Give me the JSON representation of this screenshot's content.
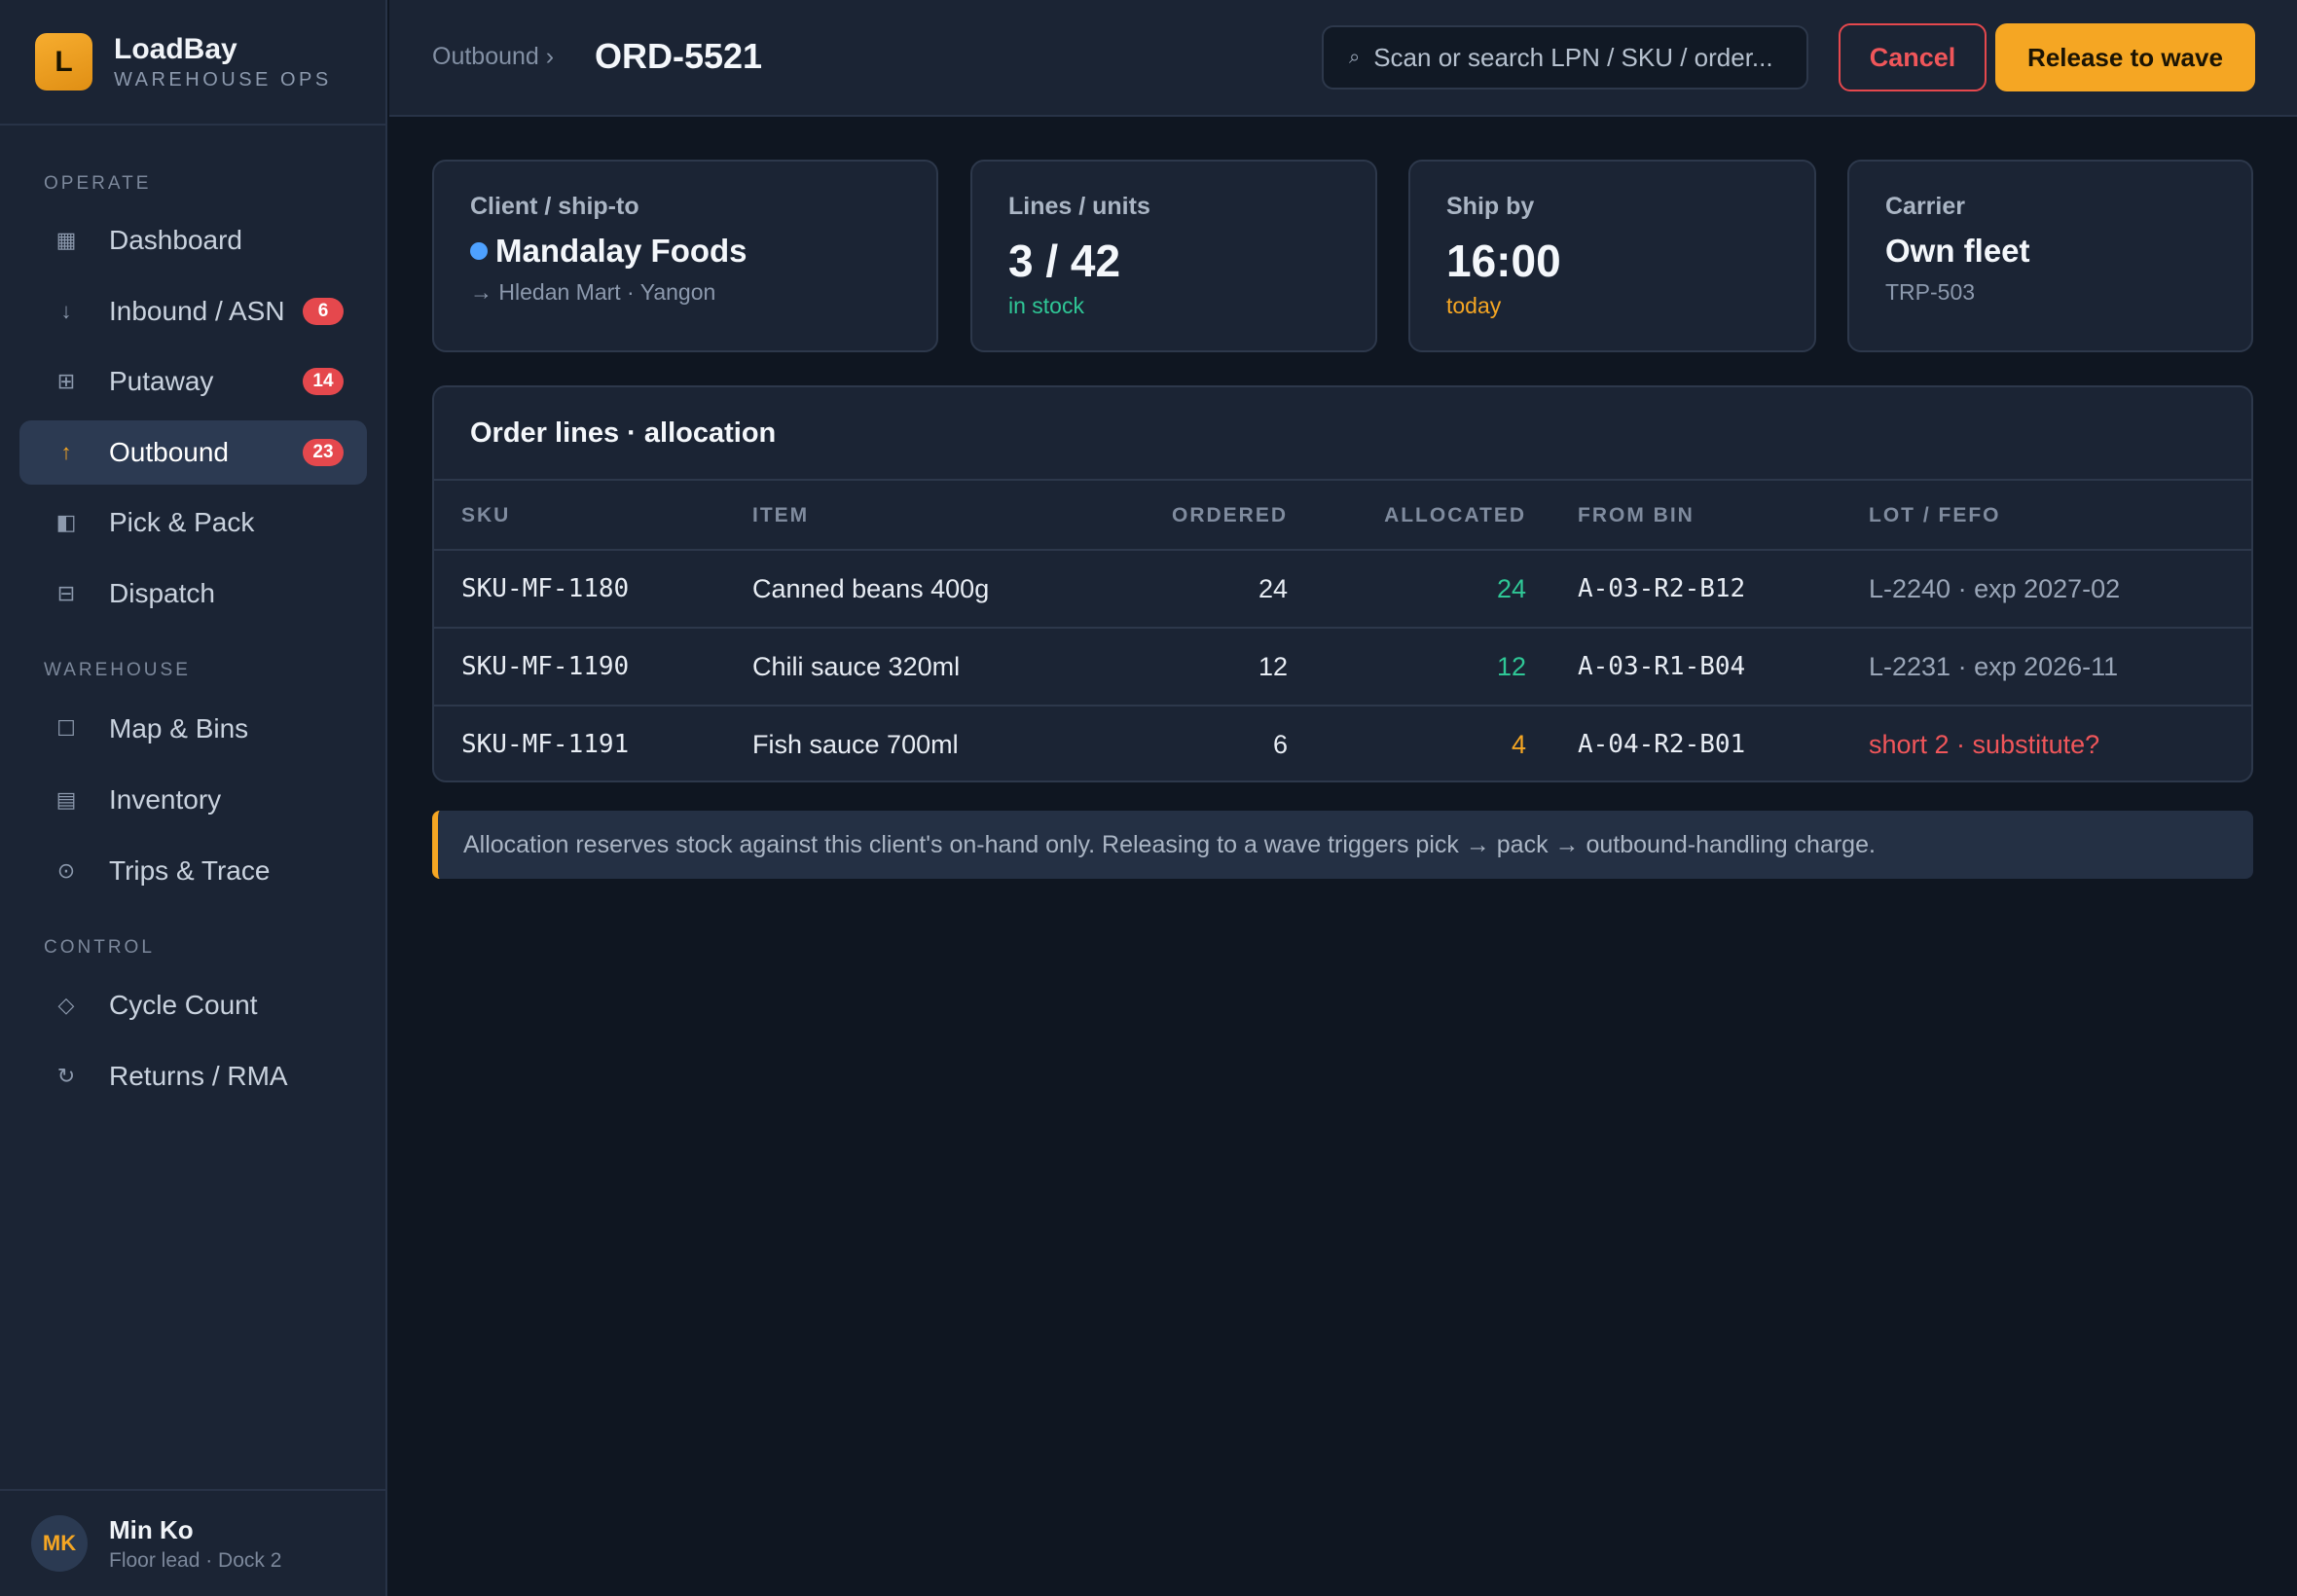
{
  "brand": {
    "logo_letter": "L",
    "name": "LoadBay",
    "subtitle": "WAREHOUSE OPS"
  },
  "sidebar": {
    "sections": [
      "OPERATE",
      "WAREHOUSE",
      "CONTROL"
    ],
    "items": [
      {
        "label": "Dashboard",
        "icon": "dashboard-icon",
        "glyph": "▦"
      },
      {
        "label": "Inbound / ASN",
        "icon": "arrow-down-icon",
        "glyph": "↓",
        "badge": "6"
      },
      {
        "label": "Putaway",
        "icon": "grid-icon",
        "glyph": "⊞",
        "badge": "14"
      },
      {
        "label": "Outbound",
        "icon": "arrow-up-icon",
        "glyph": "↑",
        "badge": "23",
        "active": true
      },
      {
        "label": "Pick & Pack",
        "icon": "box-icon",
        "glyph": "◧"
      },
      {
        "label": "Dispatch",
        "icon": "truck-icon",
        "glyph": "⊟"
      },
      {
        "label": "Map & Bins",
        "icon": "map-icon",
        "glyph": "☐"
      },
      {
        "label": "Inventory",
        "icon": "inventory-icon",
        "glyph": "▤"
      },
      {
        "label": "Trips & Trace",
        "icon": "trace-icon",
        "glyph": "⊙"
      },
      {
        "label": "Cycle Count",
        "icon": "diamond-icon",
        "glyph": "◇"
      },
      {
        "label": "Returns / RMA",
        "icon": "return-icon",
        "glyph": "↻"
      }
    ]
  },
  "user": {
    "initials": "MK",
    "name": "Min Ko",
    "role": "Floor lead · Dock 2"
  },
  "header": {
    "breadcrumb": "Outbound ›",
    "title": "ORD-5521",
    "search_placeholder": "Scan or search LPN / SKU / order...",
    "cancel_label": "Cancel",
    "release_label": "Release to wave"
  },
  "cards": {
    "client": {
      "label": "Client / ship-to",
      "value": "Mandalay Foods",
      "sub": "→ Hledan Mart · Yangon"
    },
    "lines": {
      "label": "Lines / units",
      "value": "3 / 42",
      "sub": "in stock"
    },
    "ship": {
      "label": "Ship by",
      "value": "16:00",
      "sub": "today"
    },
    "carrier": {
      "label": "Carrier",
      "value": "Own fleet",
      "sub": "TRP-503"
    }
  },
  "table": {
    "title": "Order lines · allocation",
    "columns": [
      "SKU",
      "ITEM",
      "ORDERED",
      "ALLOCATED",
      "FROM BIN",
      "LOT / FEFO"
    ],
    "rows": [
      {
        "sku": "SKU-MF-1180",
        "item": "Canned beans 400g",
        "ordered": "24",
        "allocated": "24",
        "bin": "A-03-R2-B12",
        "lot": "L-2240 · exp 2027-02"
      },
      {
        "sku": "SKU-MF-1190",
        "item": "Chili sauce 320ml",
        "ordered": "12",
        "allocated": "12",
        "bin": "A-03-R1-B04",
        "lot": "L-2231 · exp 2026-11"
      },
      {
        "sku": "SKU-MF-1191",
        "item": "Fish sauce 700ml",
        "ordered": "6",
        "allocated": "4",
        "bin": "A-04-R2-B01",
        "lot": "short 2 · substitute?"
      }
    ]
  },
  "note": "Allocation reserves stock against this client's on-hand only. Releasing to a wave triggers pick → pack → outbound-handling charge.",
  "colors": {
    "accent": "#f5a623",
    "danger": "#e5484d",
    "success": "#2fc796",
    "client_dot": "#4ea1ff"
  }
}
